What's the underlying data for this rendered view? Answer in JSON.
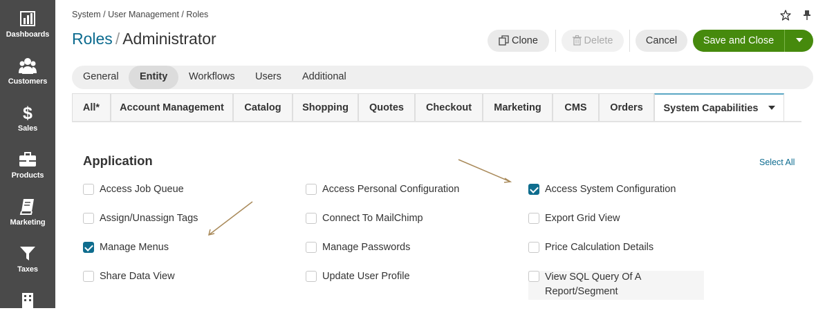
{
  "sidebar": {
    "items": [
      {
        "label": "Dashboards",
        "icon": "bar-chart-icon"
      },
      {
        "label": "Customers",
        "icon": "users-icon"
      },
      {
        "label": "Sales",
        "icon": "dollar-icon"
      },
      {
        "label": "Products",
        "icon": "briefcase-icon"
      },
      {
        "label": "Marketing",
        "icon": "book-icon"
      },
      {
        "label": "Taxes",
        "icon": "filter-icon"
      },
      {
        "label": "",
        "icon": "building-icon"
      }
    ]
  },
  "breadcrumb": "System / User Management / Roles",
  "header": {
    "title_link": "Roles",
    "title_sep": "/",
    "title_current": "Administrator",
    "clone_label": "Clone",
    "delete_label": "Delete",
    "cancel_label": "Cancel",
    "save_label": "Save and Close"
  },
  "tabs": [
    "General",
    "Entity",
    "Workflows",
    "Users",
    "Additional"
  ],
  "active_tab": "Entity",
  "subtabs": [
    "All*",
    "Account Management",
    "Catalog",
    "Shopping",
    "Quotes",
    "Checkout",
    "Marketing",
    "CMS",
    "Orders",
    "System Capabilities"
  ],
  "active_subtab": "System Capabilities",
  "section": {
    "title": "Application",
    "select_all": "Select All"
  },
  "permissions": [
    {
      "label": "Access Job Queue",
      "checked": false
    },
    {
      "label": "Access Personal Configuration",
      "checked": false
    },
    {
      "label": "Access System Configuration",
      "checked": true
    },
    {
      "label": "Assign/Unassign Tags",
      "checked": false
    },
    {
      "label": "Connect To MailChimp",
      "checked": false
    },
    {
      "label": "Export Grid View",
      "checked": false
    },
    {
      "label": "Manage Menus",
      "checked": true
    },
    {
      "label": "Manage Passwords",
      "checked": false
    },
    {
      "label": "Price Calculation Details",
      "checked": false
    },
    {
      "label": "Share Data View",
      "checked": false
    },
    {
      "label": "Update User Profile",
      "checked": false
    },
    {
      "label": "View SQL Query Of A Report/Segment",
      "checked": false
    }
  ],
  "colors": {
    "sidebar_bg": "#4a4a4a",
    "link": "#0c6b8f",
    "primary_button": "#468a0d",
    "checkbox_checked": "#0f6d8e",
    "annotation_arrow": "#a98a5a"
  }
}
